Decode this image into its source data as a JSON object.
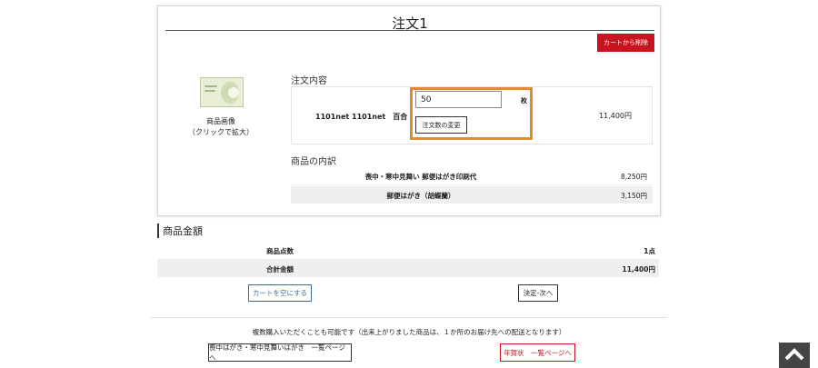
{
  "order": {
    "title": "注文1",
    "remove_label": "カートから削除",
    "image_caption_1": "商品画像",
    "image_caption_2": "（クリックで拡大）",
    "details_heading": "注文内容",
    "product_name": "1101net 1101net　百合",
    "quantity_value": "50",
    "quantity_unit": "枚",
    "change_qty_label": "注文数の変更",
    "product_price": "11,400円",
    "breakdown_heading": "商品の内訳",
    "breakdown": [
      {
        "label": "喪中・寒中見舞い 郵便はがき印刷代",
        "amount": "8,250円"
      },
      {
        "label": "郵便はがき（胡蝶蘭）",
        "amount": "3,150円"
      }
    ]
  },
  "summary": {
    "title": "商品金額",
    "count_label": "商品点数",
    "count_value": "1点",
    "total_label": "合計金額",
    "total_value": "11,400円"
  },
  "actions": {
    "empty_cart": "カートを空にする",
    "next": "決定-次へ"
  },
  "footer": {
    "notice": "複数購入いただくことも可能です（出来上がりました商品は、１か所のお届け先への配送となります）",
    "card_list_link": "喪中はがき・寒中見舞いはがき　一覧ページへ",
    "nenga_link": "年賀状　一覧ページへ"
  },
  "icons": {
    "scroll_top": "chevron-up-icon"
  },
  "colors": {
    "accent_red": "#c8141e",
    "highlight_orange": "#e08a32",
    "link_blue": "#3a6aa0"
  }
}
